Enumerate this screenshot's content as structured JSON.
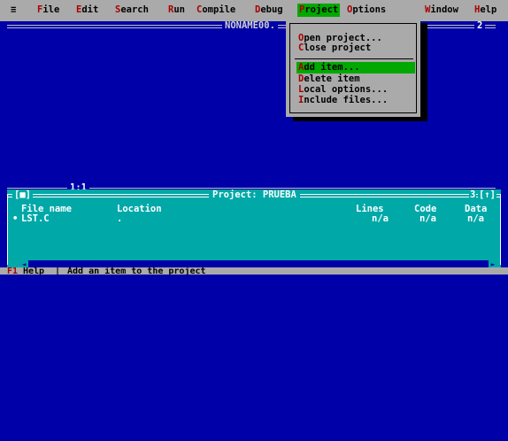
{
  "menu": {
    "system": "≡",
    "items": [
      {
        "hotkey": "F",
        "rest": "ile"
      },
      {
        "hotkey": "E",
        "rest": "dit"
      },
      {
        "hotkey": "S",
        "rest": "earch"
      },
      {
        "hotkey": "R",
        "rest": "un"
      },
      {
        "hotkey": "C",
        "rest": "ompile"
      },
      {
        "hotkey": "D",
        "rest": "ebug"
      },
      {
        "hotkey": "P",
        "rest": "roject"
      },
      {
        "hotkey": "O",
        "rest": "ptions"
      },
      {
        "hotkey": "W",
        "rest": "indow"
      },
      {
        "hotkey": "H",
        "rest": "elp"
      }
    ]
  },
  "editor": {
    "title": "NONAME00.",
    "window_number": "2",
    "cursor_position": "1:1"
  },
  "project_menu": {
    "items": [
      {
        "hotkey": "O",
        "rest": "pen project..."
      },
      {
        "hotkey": "C",
        "rest": "lose project"
      },
      {
        "hotkey": "A",
        "rest": "dd item..."
      },
      {
        "hotkey": "D",
        "rest": "elete item"
      },
      {
        "hotkey": "L",
        "rest": "ocal options..."
      },
      {
        "hotkey": "I",
        "rest": "nclude files..."
      }
    ],
    "selected_index": 2
  },
  "project_window": {
    "title": "Project: PRUEBA",
    "close_box": "[■]",
    "number": "3",
    "zoom_box": "[↑]",
    "columns": [
      "File name",
      "Location",
      "Lines",
      "Code",
      "Data"
    ],
    "rows": [
      {
        "bullet": "•",
        "file": "LST.C",
        "location": ".",
        "lines": "n/a",
        "code": "n/a",
        "data": "n/a"
      }
    ]
  },
  "status": {
    "key": "F1",
    "key_label": "Help",
    "separator": "|",
    "message": "Add an item to the project"
  },
  "colors": {
    "desktop_blue": "#0000a8",
    "menu_grey": "#aaaaaa",
    "highlight_green": "#00a800",
    "hotkey_red": "#a80000",
    "project_cyan": "#00a8a8"
  }
}
